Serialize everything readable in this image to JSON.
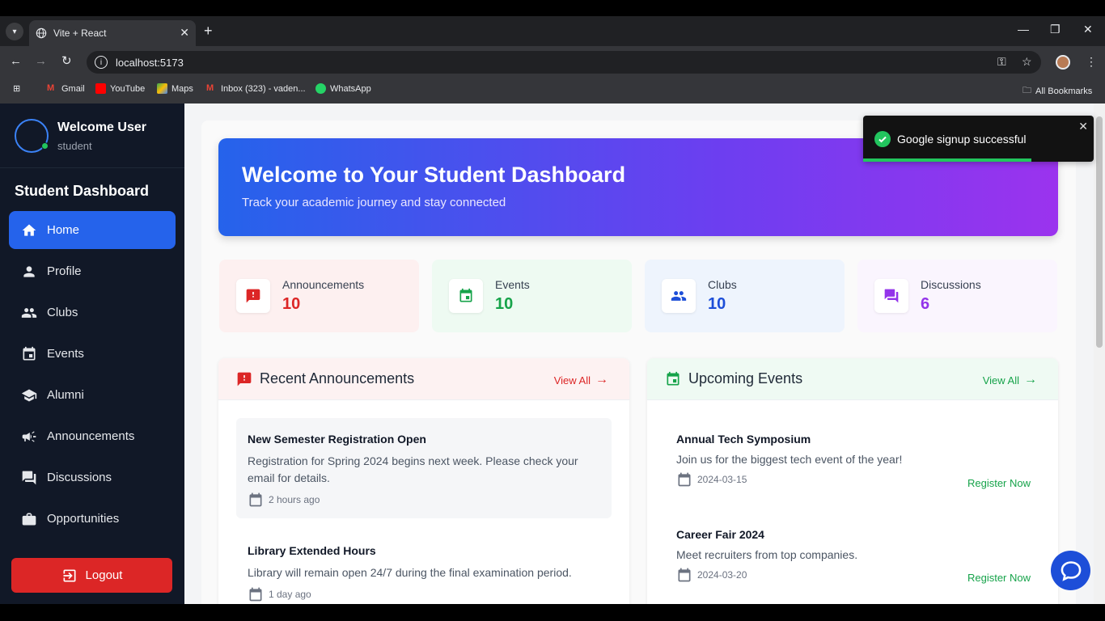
{
  "browser": {
    "tab_title": "Vite + React",
    "url": "localhost:5173",
    "bookmarks": [
      "Gmail",
      "YouTube",
      "Maps",
      "Inbox (323) - vaden...",
      "WhatsApp"
    ],
    "all_bookmarks": "All Bookmarks"
  },
  "sidebar": {
    "user_name": "Welcome User",
    "user_role": "student",
    "title": "Student Dashboard",
    "items": [
      {
        "label": "Home",
        "icon": "home-icon"
      },
      {
        "label": "Profile",
        "icon": "person-icon"
      },
      {
        "label": "Clubs",
        "icon": "group-icon"
      },
      {
        "label": "Events",
        "icon": "calendar-icon"
      },
      {
        "label": "Alumni",
        "icon": "graduation-cap-icon"
      },
      {
        "label": "Announcements",
        "icon": "megaphone-icon"
      },
      {
        "label": "Discussions",
        "icon": "forum-icon"
      },
      {
        "label": "Opportunities",
        "icon": "briefcase-icon"
      }
    ],
    "logout_label": "Logout"
  },
  "hero": {
    "title": "Welcome to Your Student Dashboard",
    "subtitle": "Track your academic journey and stay connected"
  },
  "stats": [
    {
      "label": "Announcements",
      "value": "10",
      "color": "#dc2626",
      "bg": "#fdf0f0"
    },
    {
      "label": "Events",
      "value": "10",
      "color": "#16a34a",
      "bg": "#eefaf2"
    },
    {
      "label": "Clubs",
      "value": "10",
      "color": "#1d4ed8",
      "bg": "#eef4fd"
    },
    {
      "label": "Discussions",
      "value": "6",
      "color": "#9333ea",
      "bg": "#faf5fe"
    }
  ],
  "announcements": {
    "title": "Recent Announcements",
    "view_all": "View All",
    "items": [
      {
        "title": "New Semester Registration Open",
        "desc": "Registration for Spring 2024 begins next week. Please check your email for details.",
        "time": "2 hours ago"
      },
      {
        "title": "Library Extended Hours",
        "desc": "Library will remain open 24/7 during the final examination period.",
        "time": "1 day ago"
      }
    ]
  },
  "events": {
    "title": "Upcoming Events",
    "view_all": "View All",
    "register_label": "Register Now",
    "items": [
      {
        "title": "Annual Tech Symposium",
        "desc": "Join us for the biggest tech event of the year!",
        "date": "2024-03-15"
      },
      {
        "title": "Career Fair 2024",
        "desc": "Meet recruiters from top companies.",
        "date": "2024-03-20"
      }
    ]
  },
  "toast": {
    "message": "Google signup successful"
  }
}
